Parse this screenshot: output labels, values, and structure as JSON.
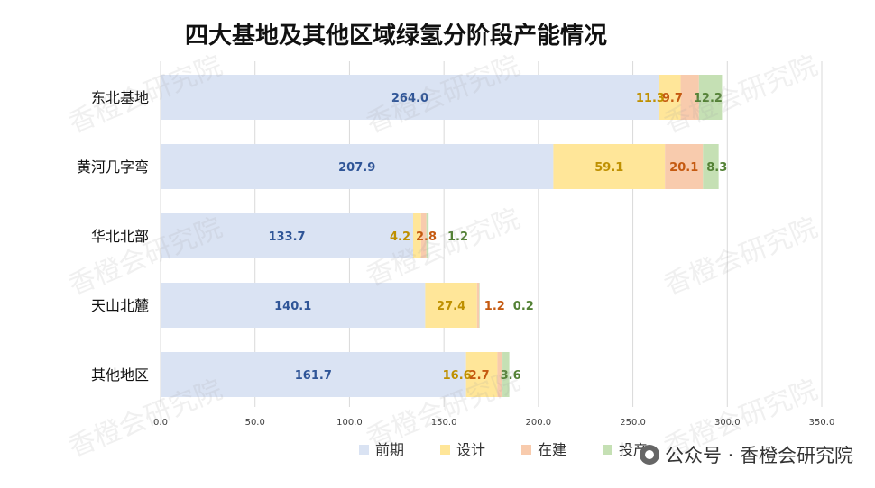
{
  "chart_data": {
    "type": "bar",
    "orientation": "horizontal",
    "stacked": true,
    "title": "四大基地及其他区域绿氢分阶段产能情况",
    "categories": [
      "东北基地",
      "黄河几字弯",
      "华北北部",
      "天山北麓",
      "其他地区"
    ],
    "series": [
      {
        "name": "前期",
        "values": [
          264.0,
          207.9,
          133.7,
          140.1,
          161.7
        ],
        "color": "#dae3f3",
        "label_color": "#2f5597"
      },
      {
        "name": "设计",
        "values": [
          11.3,
          59.1,
          4.2,
          27.4,
          16.6
        ],
        "color": "#ffe699",
        "label_color": "#bf9000"
      },
      {
        "name": "在建",
        "values": [
          9.7,
          20.1,
          2.8,
          1.2,
          2.7
        ],
        "color": "#f8cbad",
        "label_color": "#c55a11"
      },
      {
        "name": "投产",
        "values": [
          12.2,
          8.3,
          1.2,
          0.2,
          3.6
        ],
        "color": "#c5e0b4",
        "label_color": "#538135"
      }
    ],
    "xlim": [
      0,
      350
    ],
    "xticks": [
      "0.0",
      "50.0",
      "100.0",
      "150.0",
      "200.0",
      "250.0",
      "300.0",
      "350.0"
    ],
    "grid": true,
    "legend": "bottom"
  },
  "watermark": "香橙会研究院",
  "credit": "公众号 · 香橙会研究院",
  "credit_icon": "wechat-icon"
}
